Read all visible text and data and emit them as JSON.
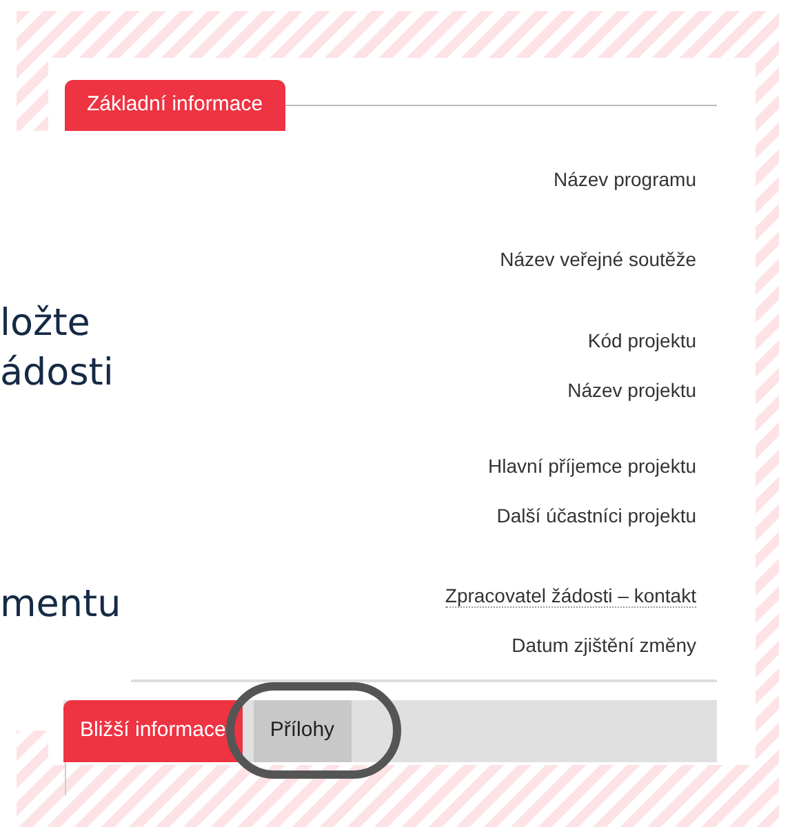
{
  "section_tab": {
    "label": "Základní informace",
    "selected": true
  },
  "slide_text": [
    "ložte",
    "ádosti",
    "mentu"
  ],
  "fields": [
    {
      "label": "Název programu",
      "kind": "plain"
    },
    {
      "label": "Název veřejné soutěže",
      "kind": "plain"
    },
    {
      "label": "Kód projektu",
      "kind": "plain"
    },
    {
      "label": "Název projektu",
      "kind": "plain"
    },
    {
      "label": "Hlavní příjemce projektu",
      "kind": "plain"
    },
    {
      "label": "Další účastníci projektu",
      "kind": "plain"
    },
    {
      "label": "Zpracovatel žádosti – kontakt",
      "kind": "hint"
    },
    {
      "label": "Datum zjištění změny",
      "kind": "plain"
    }
  ],
  "tabs": [
    {
      "label": "Bližší informace",
      "selected": true,
      "circled": false
    },
    {
      "label": "Přílohy",
      "selected": false,
      "circled": true
    }
  ]
}
